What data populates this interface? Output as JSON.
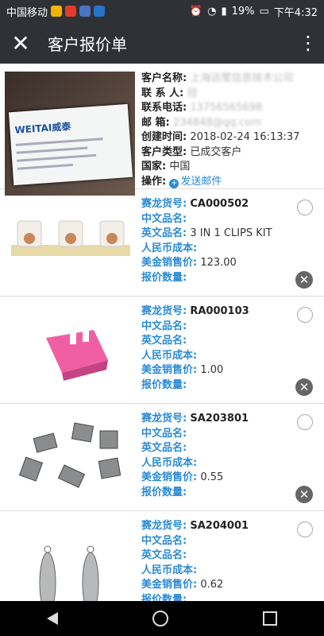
{
  "status": {
    "carrier": "中国移动",
    "battery": "19%",
    "time": "下午4:32"
  },
  "header": {
    "title": "客户报价单"
  },
  "customer": {
    "rows": [
      {
        "label": "客户名称:",
        "value": "上海迅鹭信息技术公司",
        "blurred": true
      },
      {
        "label": "联 系 人:",
        "value": "冠",
        "blurred": true
      },
      {
        "label": "联系电话:",
        "value": "13756565698",
        "blurred": true
      },
      {
        "label": "邮    箱:",
        "value": "234848@qq.com",
        "blurred": true
      },
      {
        "label": "创建时间:",
        "value": "2018-02-24 16:13:37",
        "blurred": false
      },
      {
        "label": "客户类型:",
        "value": "已成交客户",
        "blurred": false
      },
      {
        "label": "国家:",
        "value": "中国",
        "blurred": false
      }
    ],
    "op_label": "操作:",
    "send_mail": "发送邮件",
    "card_logo": "WEITAI威泰"
  },
  "products": [
    {
      "code": "CA000502",
      "cn_name": "",
      "en_name": "3 IN 1 CLIPS KIT",
      "rmb_cost": "",
      "usd_price": "123.00",
      "qty": "",
      "img": "clips-kit"
    },
    {
      "code": "RA000103",
      "cn_name": "",
      "en_name": "",
      "rmb_cost": "",
      "usd_price": "1.00",
      "qty": "",
      "img": "pink-holder"
    },
    {
      "code": "SA203801",
      "cn_name": "",
      "en_name": "",
      "rmb_cost": "",
      "usd_price": "0.55",
      "qty": "",
      "img": "metal-clips"
    },
    {
      "code": "SA204001",
      "cn_name": "",
      "en_name": "",
      "rmb_cost": "",
      "usd_price": "0.62",
      "qty": "",
      "img": "feather-charms"
    }
  ],
  "labels": {
    "code": "赛龙货号:",
    "cn_name": "中文品名:",
    "en_name": "英文品名:",
    "rmb_cost": "人民币成本:",
    "usd_price": "美金销售价:",
    "qty": "报价数量:"
  }
}
